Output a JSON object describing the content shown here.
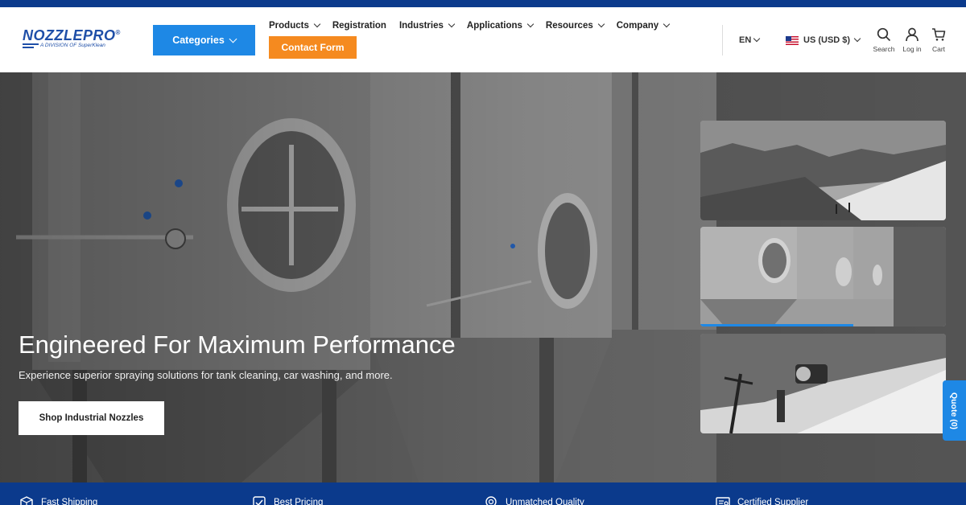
{
  "logo": {
    "brand": "NOZZLEPRO",
    "mark": "®",
    "tagline": "A DIVISION OF SuperKlean"
  },
  "header": {
    "categories_label": "Categories",
    "nav": [
      {
        "label": "Products",
        "dropdown": true
      },
      {
        "label": "Registration",
        "dropdown": false
      },
      {
        "label": "Industries",
        "dropdown": true
      },
      {
        "label": "Applications",
        "dropdown": true
      },
      {
        "label": "Resources",
        "dropdown": true
      },
      {
        "label": "Company",
        "dropdown": true
      }
    ],
    "contact_label": "Contact Form",
    "language": "EN",
    "currency": "US (USD $)",
    "utilities": [
      {
        "label": "Search",
        "icon": "search-icon"
      },
      {
        "label": "Log in",
        "icon": "user-icon"
      },
      {
        "label": "Cart",
        "icon": "cart-icon"
      }
    ]
  },
  "hero": {
    "title": "Engineered For Maximum Performance",
    "subtitle": "Experience superior spraying solutions for tank cleaning, car washing, and more.",
    "button_label": "Shop Industrial Nozzles",
    "thumbnails": [
      {
        "name": "snowy-mountain-thumbnail"
      },
      {
        "name": "steel-tanks-thumbnail",
        "active": true
      },
      {
        "name": "snow-cannon-thumbnail"
      }
    ]
  },
  "quote_tab": {
    "label": "Quote (0)"
  },
  "features": [
    {
      "label": "Fast Shipping",
      "icon": "box-icon"
    },
    {
      "label": "Best Pricing",
      "icon": "check-icon"
    },
    {
      "label": "Unmatched Quality",
      "icon": "badge-icon"
    },
    {
      "label": "Certified Supplier",
      "icon": "certificate-icon"
    }
  ],
  "colors": {
    "brand_blue": "#1f4fa8",
    "navy": "#0b3a8c",
    "accent_blue": "#1e88e5",
    "accent_orange": "#f58a1f"
  }
}
